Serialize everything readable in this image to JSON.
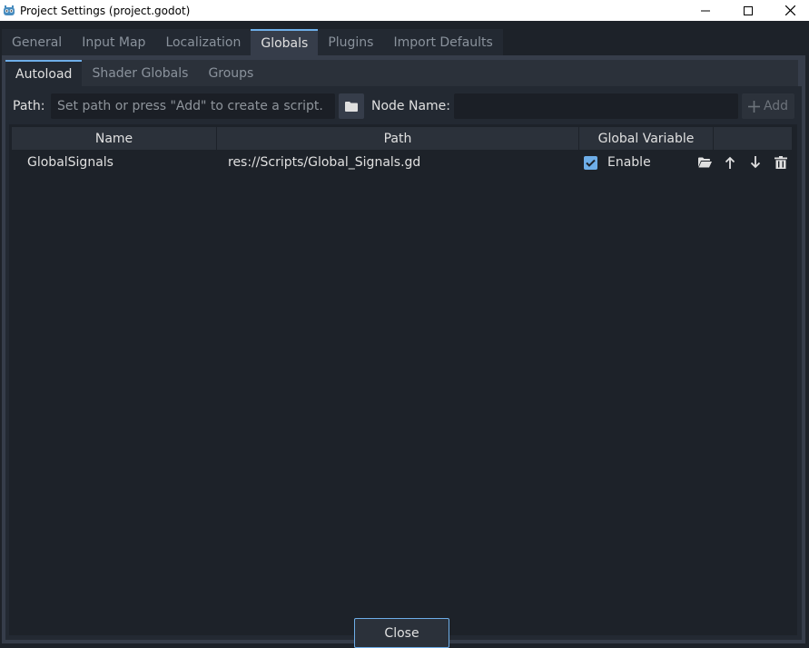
{
  "window": {
    "title": "Project Settings (project.godot)"
  },
  "main_tabs": [
    {
      "label": "General"
    },
    {
      "label": "Input Map"
    },
    {
      "label": "Localization"
    },
    {
      "label": "Globals"
    },
    {
      "label": "Plugins"
    },
    {
      "label": "Import Defaults"
    }
  ],
  "active_main_tab": "Globals",
  "sub_tabs": [
    {
      "label": "Autoload"
    },
    {
      "label": "Shader Globals"
    },
    {
      "label": "Groups"
    }
  ],
  "active_sub_tab": "Autoload",
  "path_row": {
    "path_label": "Path:",
    "path_placeholder": "Set path or press \"Add\" to create a script.",
    "path_value": "",
    "node_name_label": "Node Name:",
    "node_name_value": "",
    "add_label": "Add"
  },
  "table": {
    "columns": [
      "Name",
      "Path",
      "Global Variable",
      ""
    ],
    "rows": [
      {
        "name": "GlobalSignals",
        "path": "res://Scripts/Global_Signals.gd",
        "global_enabled": true,
        "global_label": "Enable"
      }
    ]
  },
  "footer": {
    "close_label": "Close"
  },
  "colors": {
    "accent": "#6eaee8",
    "panel": "#363d4a",
    "background": "#1d2229",
    "text": "#e0e0e0",
    "text_dim": "#8a929c"
  },
  "icons": {
    "app": "godot-icon",
    "browse": "folder-icon",
    "add": "plus-icon",
    "row_actions": [
      "folder-open-icon",
      "arrow-up-icon",
      "arrow-down-icon",
      "trash-icon"
    ],
    "window_controls": [
      "minimize-icon",
      "maximize-icon",
      "close-icon"
    ]
  }
}
